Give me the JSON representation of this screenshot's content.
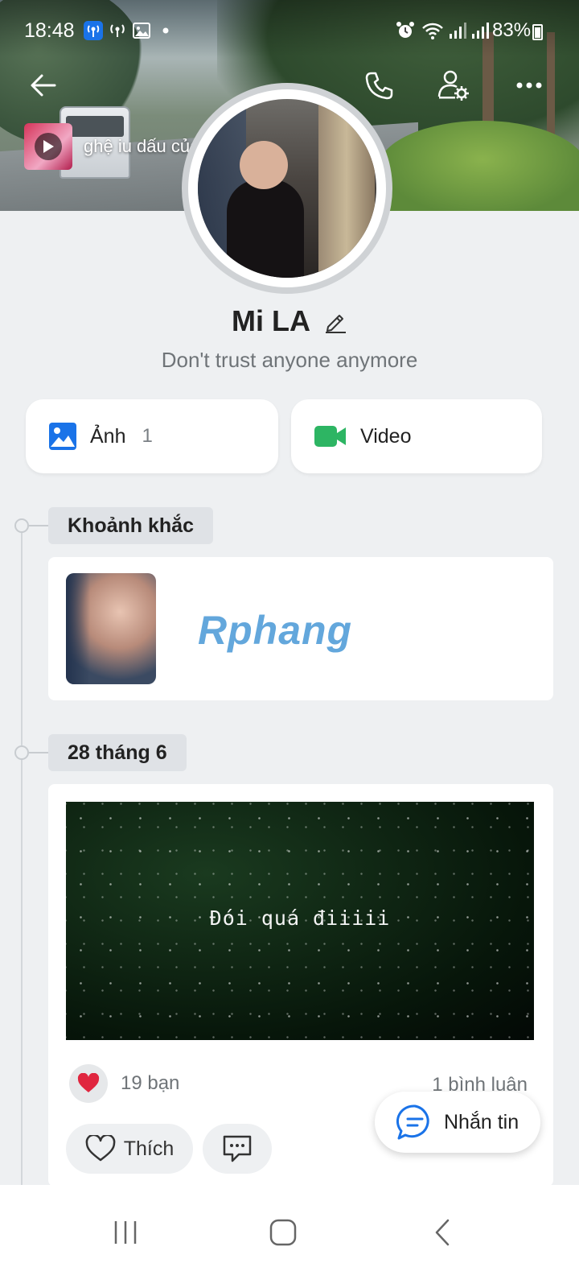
{
  "status_bar": {
    "time": "18:48",
    "battery": "83%"
  },
  "music": {
    "title": "ghệ iu dấu của"
  },
  "profile": {
    "name": "Mi LA",
    "bio": "Don't trust anyone anymore"
  },
  "media": [
    {
      "label": "Ảnh",
      "count": "1",
      "icon": "image-icon",
      "color": "#1a73e8"
    },
    {
      "label": "Video",
      "count": "",
      "icon": "video-icon",
      "color": "#2db563"
    }
  ],
  "timeline": {
    "moments_label": "Khoảnh khắc",
    "watermark": "Rphang",
    "date_label": "28 tháng 6"
  },
  "post": {
    "caption": "Đói quá điiiii",
    "reaction_count": "19 bạn",
    "comments": "1 bình luận",
    "like_label": "Thích"
  },
  "fab": {
    "label": "Nhắn tin"
  },
  "colors": {
    "accent": "#1a73e8",
    "heart": "#e0263f",
    "background": "#eef0f2"
  }
}
